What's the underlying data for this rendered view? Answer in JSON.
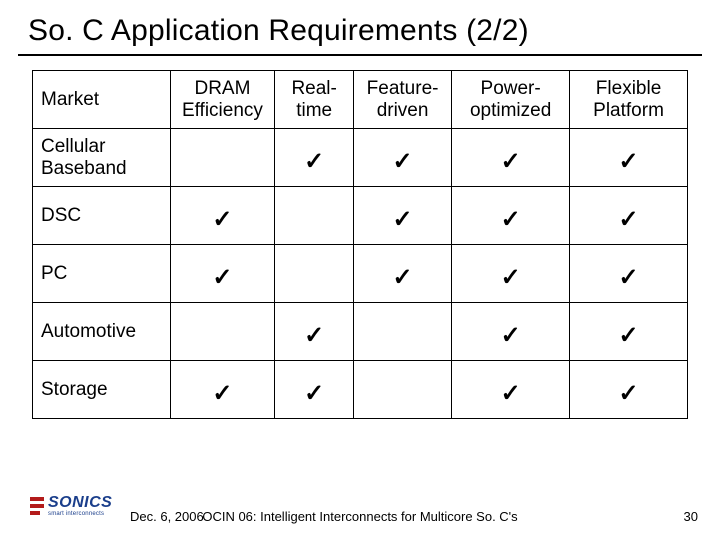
{
  "title": "So. C Application Requirements (2/2)",
  "columns": [
    "Market",
    "DRAM Efficiency",
    "Realtime",
    "Featuredriven",
    "Poweroptimized",
    "Flexible Platform"
  ],
  "column_wrap": [
    "Market",
    "DRAM\nEfficiency",
    "Real-\ntime",
    "Feature-\ndriven",
    "Power-\noptimized",
    "Flexible\nPlatform"
  ],
  "rows": [
    {
      "label": "Cellular Baseband",
      "cells": [
        false,
        true,
        true,
        true,
        true
      ]
    },
    {
      "label": "DSC",
      "cells": [
        true,
        false,
        true,
        true,
        true
      ]
    },
    {
      "label": "PC",
      "cells": [
        true,
        false,
        true,
        true,
        true
      ]
    },
    {
      "label": "Automotive",
      "cells": [
        false,
        true,
        false,
        true,
        true
      ]
    },
    {
      "label": "Storage",
      "cells": [
        true,
        true,
        false,
        true,
        true
      ]
    }
  ],
  "check_glyph": "✓",
  "footer": {
    "date": "Dec. 6, 2006",
    "middle": "OCIN 06: Intelligent Interconnects for Multicore So. C's",
    "page": "30"
  },
  "logo": {
    "brand": "SONICS",
    "tag": "smart interconnects"
  },
  "chart_data": {
    "type": "table",
    "title": "So. C Application Requirements (2/2)",
    "columns": [
      "Market",
      "DRAM Efficiency",
      "Realtime",
      "Featuredriven",
      "Poweroptimized",
      "Flexible Platform"
    ],
    "data": [
      [
        "Cellular Baseband",
        false,
        true,
        true,
        true,
        true
      ],
      [
        "DSC",
        true,
        false,
        true,
        true,
        true
      ],
      [
        "PC",
        true,
        false,
        true,
        true,
        true
      ],
      [
        "Automotive",
        false,
        true,
        false,
        true,
        true
      ],
      [
        "Storage",
        true,
        true,
        false,
        true,
        true
      ]
    ]
  }
}
